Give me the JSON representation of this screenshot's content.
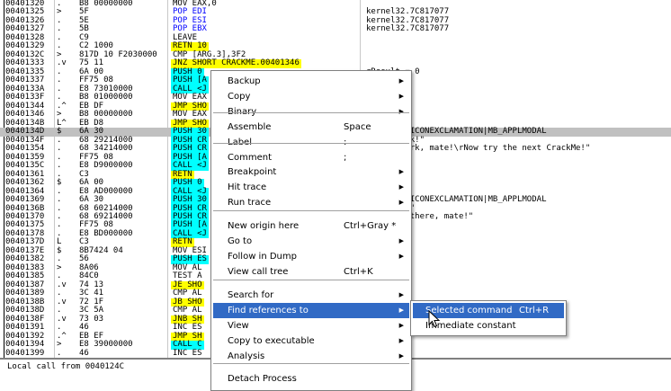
{
  "disasm_rows": [
    {
      "addr": "00401320",
      "mark": ".",
      "hex": "B8 00000000",
      "cmd": "MOV EAX,0",
      "cls": "",
      "cmt": ""
    },
    {
      "addr": "00401325",
      "mark": ">",
      "hex": "5F",
      "cmd": "POP EDI",
      "cls": "hl-b",
      "cmt": "kernel32.7C817077"
    },
    {
      "addr": "00401326",
      "mark": ".",
      "hex": "5E",
      "cmd": "POP ESI",
      "cls": "hl-b",
      "cmt": "kernel32.7C817077"
    },
    {
      "addr": "00401327",
      "mark": ".",
      "hex": "5B",
      "cmd": "POP EBX",
      "cls": "hl-b",
      "cmt": "kernel32.7C817077"
    },
    {
      "addr": "00401328",
      "mark": ".",
      "hex": "C9",
      "cmd": "LEAVE",
      "cls": "",
      "cmt": ""
    },
    {
      "addr": "00401329",
      "mark": ".",
      "hex": "C2 1000",
      "cmd": "RETN 10",
      "cls": "hl-y",
      "cmt": ""
    },
    {
      "addr": "0040132C",
      "mark": ">",
      "hex": "817D 10 F2030000",
      "cmd": "CMP [ARG.3],3F2",
      "cls": "",
      "cmt": ""
    },
    {
      "addr": "00401333",
      "mark": ".v",
      "hex": "75 11",
      "cmd": "JNZ SHORT CRACKME.00401346",
      "cls": "hl-y",
      "cmt": ""
    },
    {
      "addr": "00401335",
      "mark": ".",
      "hex": "6A 00",
      "cmd": "PUSH 0",
      "cls": "hl-c",
      "cmt": "rResult = 0"
    },
    {
      "addr": "00401337",
      "mark": ".",
      "hex": "FF75 08",
      "cmd": "PUSH [A",
      "cls": "hl-c",
      "cmt": "00401000"
    },
    {
      "addr": "0040133A",
      "mark": ".",
      "hex": "E8 73010000",
      "cmd": "CALL <J",
      "cls": "hl-c",
      "cmt": ""
    },
    {
      "addr": "0040133F",
      "mark": ".",
      "hex": "B8 01000000",
      "cmd": "MOV EAX",
      "cls": "",
      "cmt": ""
    },
    {
      "addr": "00401344",
      "mark": ".^",
      "hex": "EB DF",
      "cmd": "JMP SHO",
      "cls": "hl-y",
      "cmt": ""
    },
    {
      "addr": "00401346",
      "mark": ">",
      "hex": "B8 00000000",
      "cmd": "MOV EAX",
      "cls": "",
      "cmt": ""
    },
    {
      "addr": "0040134B",
      "mark": "L^",
      "hex": "EB D8",
      "cmd": "JMP SHO",
      "cls": "hl-y",
      "cmt": ""
    },
    {
      "addr": "0040134D",
      "mark": "$",
      "hex": "6A 30",
      "cmd": "PUSH 30",
      "cls": "hl-c",
      "cmt": "MB_OK|MB_ICONEXCLAMATION|MB_APPLMODAL",
      "sel": true
    },
    {
      "addr": "0040134F",
      "mark": ".",
      "hex": "68 29214000",
      "cmd": "PUSH CR",
      "cls": "hl-c",
      "cmt": "\"Good work!\""
    },
    {
      "addr": "00401354",
      "mark": ".",
      "hex": "68 34214000",
      "cmd": "PUSH CR",
      "cls": "hl-c",
      "cmt": "\"Great work, mate!\\rNow try the next CrackMe!\""
    },
    {
      "addr": "00401359",
      "mark": ".",
      "hex": "FF75 08",
      "cmd": "PUSH [A",
      "cls": "hl-c",
      "cmt": "00401000"
    },
    {
      "addr": "0040135C",
      "mark": ".",
      "hex": "E8 D9000000",
      "cmd": "CALL <J",
      "cls": "hl-c",
      "cmt": "xA"
    },
    {
      "addr": "00401361",
      "mark": ".",
      "hex": "C3",
      "cmd": "RETN",
      "cls": "hl-y",
      "cmt": ""
    },
    {
      "addr": "00401362",
      "mark": "$",
      "hex": "6A 00",
      "cmd": "PUSH 0",
      "cls": "hl-c",
      "cmt": "= MB_OK"
    },
    {
      "addr": "00401364",
      "mark": ".",
      "hex": "E8 AD000000",
      "cmd": "CALL <J",
      "cls": "hl-c",
      "cmt": "eep"
    },
    {
      "addr": "00401369",
      "mark": ".",
      "hex": "6A 30",
      "cmd": "PUSH 30",
      "cls": "hl-c",
      "cmt": "MB_OK|MB_ICONEXCLAMATION|MB_APPLMODAL"
    },
    {
      "addr": "0040136B",
      "mark": ".",
      "hex": "68 60214000",
      "cmd": "PUSH CR",
      "cls": "hl-c",
      "cmt": "\"No luck!\""
    },
    {
      "addr": "00401370",
      "mark": ".",
      "hex": "68 69214000",
      "cmd": "PUSH CR",
      "cls": "hl-c",
      "cmt": "\"No luck there, mate!\""
    },
    {
      "addr": "00401375",
      "mark": ".",
      "hex": "FF75 08",
      "cmd": "PUSH [A",
      "cls": "hl-c",
      "cmt": "00401000"
    },
    {
      "addr": "00401378",
      "mark": ".",
      "hex": "E8 BD000000",
      "cmd": "CALL <J",
      "cls": "hl-c",
      "cmt": "xA"
    },
    {
      "addr": "0040137D",
      "mark": "L",
      "hex": "C3",
      "cmd": "RETN",
      "cls": "hl-y",
      "cmt": ""
    },
    {
      "addr": "0040137E",
      "mark": "$",
      "hex": "8B7424 04",
      "cmd": "MOV ESI",
      "cls": "",
      "cmt": "010228"
    },
    {
      "addr": "00401382",
      "mark": ".",
      "hex": "56",
      "cmd": "PUSH ES",
      "cls": "hl-c",
      "cmt": ""
    },
    {
      "addr": "00401383",
      "mark": ">",
      "hex": "8A06",
      "cmd": "MOV AL",
      "cls": "",
      "cmt": ""
    },
    {
      "addr": "00401385",
      "mark": ".",
      "hex": "84C0",
      "cmd": "TEST A",
      "cls": "",
      "cmt": ""
    },
    {
      "addr": "00401387",
      "mark": ".v",
      "hex": "74 13",
      "cmd": "JE SHO",
      "cls": "hl-y",
      "cmt": ""
    },
    {
      "addr": "00401389",
      "mark": ".",
      "hex": "3C 41",
      "cmd": "CMP AL",
      "cls": "",
      "cmt": ""
    },
    {
      "addr": "0040138B",
      "mark": ".v",
      "hex": "72 1F",
      "cmd": "JB SHO",
      "cls": "hl-y",
      "cmt": ""
    },
    {
      "addr": "0040138D",
      "mark": ".",
      "hex": "3C 5A",
      "cmd": "CMP AL",
      "cls": "",
      "cmt": ""
    },
    {
      "addr": "0040138F",
      "mark": ".v",
      "hex": "73 03",
      "cmd": "JNB SH",
      "cls": "hl-y",
      "cmt": ""
    },
    {
      "addr": "00401391",
      "mark": ".",
      "hex": "46",
      "cmd": "INC ES",
      "cls": "",
      "cmt": ""
    },
    {
      "addr": "00401392",
      "mark": ".^",
      "hex": "EB EF",
      "cmd": "JMP SH",
      "cls": "hl-y",
      "cmt": ""
    },
    {
      "addr": "00401394",
      "mark": ">",
      "hex": "E8 39000000",
      "cmd": "CALL C",
      "cls": "hl-c",
      "cmt": ""
    },
    {
      "addr": "00401399",
      "mark": ".",
      "hex": "46",
      "cmd": "INC ES",
      "cls": "",
      "cmt": ""
    }
  ],
  "info_pane": {
    "text": "Local call from 0040124C"
  },
  "context_menu": {
    "items": [
      {
        "label": "Backup",
        "shortcut": "",
        "submenu": true
      },
      {
        "label": "Copy",
        "shortcut": "",
        "submenu": true
      },
      {
        "label": "Binary",
        "shortcut": "",
        "submenu": true
      },
      {
        "label": "Assemble",
        "shortcut": "Space",
        "submenu": false
      },
      {
        "label": "Label",
        "shortcut": ":",
        "submenu": false
      },
      {
        "label": "Comment",
        "shortcut": ";",
        "submenu": false
      },
      {
        "label": "Breakpoint",
        "shortcut": "",
        "submenu": true
      },
      {
        "label": "Hit trace",
        "shortcut": "",
        "submenu": true
      },
      {
        "label": "Run trace",
        "shortcut": "",
        "submenu": true
      },
      {
        "label": "New origin here",
        "shortcut": "Ctrl+Gray *",
        "submenu": false
      },
      {
        "label": "Go to",
        "shortcut": "",
        "submenu": true
      },
      {
        "label": "Follow in Dump",
        "shortcut": "",
        "submenu": true
      },
      {
        "label": "View call tree",
        "shortcut": "Ctrl+K",
        "submenu": false
      },
      {
        "label": "Search for",
        "shortcut": "",
        "submenu": true
      },
      {
        "label": "Find references to",
        "shortcut": "",
        "submenu": true,
        "active": true
      },
      {
        "label": "View",
        "shortcut": "",
        "submenu": true
      },
      {
        "label": "Copy to executable",
        "shortcut": "",
        "submenu": true
      },
      {
        "label": "Analysis",
        "shortcut": "",
        "submenu": true
      },
      {
        "label": "Detach Process",
        "shortcut": "",
        "submenu": false
      }
    ]
  },
  "submenu": {
    "items": [
      {
        "label": "Selected command",
        "shortcut": "Ctrl+R",
        "active": true
      },
      {
        "label": "Immediate constant",
        "shortcut": ""
      }
    ]
  },
  "colors": {
    "selection": "#316ac5",
    "jump_highlight": "#ffff00",
    "call_push_highlight": "#00ffff"
  },
  "icons": {
    "submenu_arrow": "triangle-right-icon",
    "cursor": "mouse-pointer-icon"
  }
}
